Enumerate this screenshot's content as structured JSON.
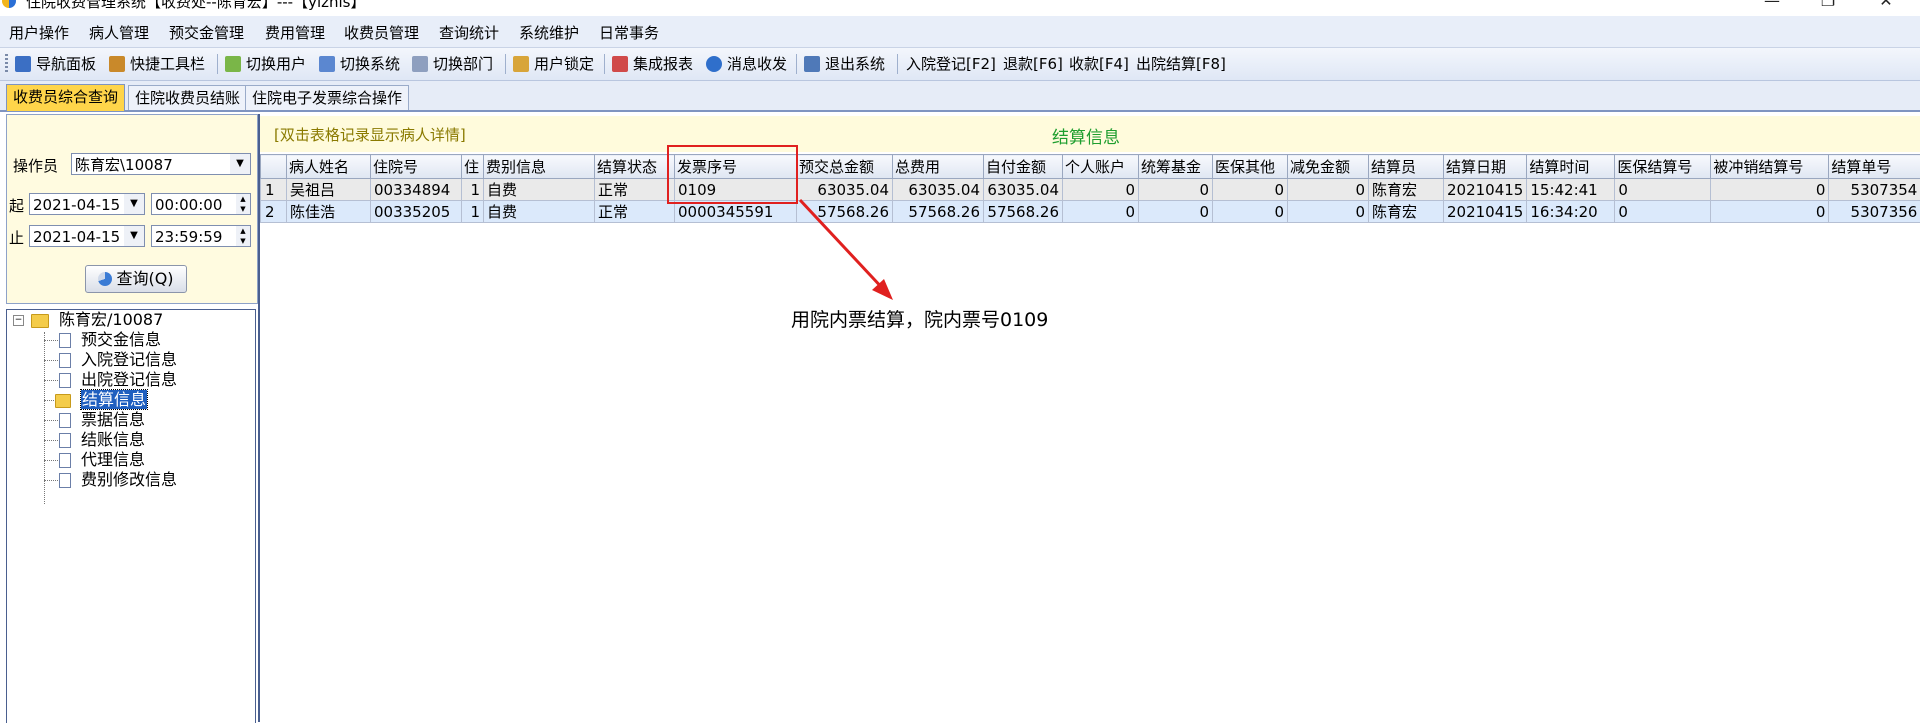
{
  "window": {
    "title": "住院收费管理系统【收费处--陈育宏】---【ylzhis】",
    "controls": [
      "—",
      "❐",
      "✕"
    ]
  },
  "menu": [
    "用户操作",
    "病人管理",
    "预交金管理",
    "费用管理",
    "收费员管理",
    "查询统计",
    "系统维护",
    "日常事务"
  ],
  "toolbar": [
    {
      "label": "导航面板",
      "icon": "navigation-panel-icon"
    },
    {
      "label": "快捷工具栏",
      "icon": "shortcut-toolbar-icon"
    },
    {
      "label": "切换用户",
      "icon": "switch-user-icon"
    },
    {
      "label": "切换系统",
      "icon": "switch-system-icon"
    },
    {
      "label": "切换部门",
      "icon": "switch-department-icon"
    },
    {
      "label": "用户锁定",
      "icon": "user-lock-icon"
    },
    {
      "label": "集成报表",
      "icon": "report-icon"
    },
    {
      "label": "消息收发",
      "icon": "message-icon"
    },
    {
      "label": "退出系统",
      "icon": "exit-icon"
    },
    {
      "label": "入院登记[F2]"
    },
    {
      "label": "退款[F6]"
    },
    {
      "label": "收款[F4]"
    },
    {
      "label": "出院结算[F8]"
    }
  ],
  "tabs": [
    "收费员综合查询",
    "住院收费员结账",
    "住院电子发票综合操作"
  ],
  "query": {
    "operator_label": "操作员",
    "operator_value": "陈育宏\\10087",
    "start_label": "起",
    "start_date": "2021-04-15",
    "start_time": "00:00:00",
    "end_label": "止",
    "end_date": "2021-04-15",
    "end_time": "23:59:59",
    "button_label": "查询(Q)"
  },
  "tree": {
    "root": "陈育宏/10087",
    "items": [
      "预交金信息",
      "入院登记信息",
      "出院登记信息",
      "结算信息",
      "票据信息",
      "结账信息",
      "代理信息",
      "费别修改信息"
    ],
    "selected": "结算信息"
  },
  "main": {
    "hint": "[双击表格记录显示病人详情]",
    "title": "结算信息",
    "columns": [
      "",
      "病人姓名",
      "住院号",
      "住",
      "费别信息",
      "结算状态",
      "发票序号",
      "预交总金额",
      "总费用",
      "自付金额",
      "个人账户",
      "统筹基金",
      "医保其他",
      "减免金额",
      "结算员",
      "结算日期",
      "结算时间",
      "医保结算号",
      "被冲销结算号",
      "结算单号"
    ],
    "rows": [
      [
        "1",
        "吴祖吕",
        "00334894",
        "1",
        "自费",
        "正常",
        "0109",
        "63035.04",
        "63035.04",
        "63035.04",
        "0",
        "0",
        "0",
        "0",
        "陈育宏",
        "20210415",
        "15:42:41",
        "0",
        "0",
        "5307354"
      ],
      [
        "2",
        "陈佳浩",
        "00335205",
        "1",
        "自费",
        "正常",
        "0000345591",
        "57568.26",
        "57568.26",
        "57568.26",
        "0",
        "0",
        "0",
        "0",
        "陈育宏",
        "20210415",
        "16:34:20",
        "0",
        "0",
        "5307356"
      ]
    ]
  },
  "annotation": {
    "text": "用院内票结算，院内票号0109",
    "color": "#e0201f"
  }
}
